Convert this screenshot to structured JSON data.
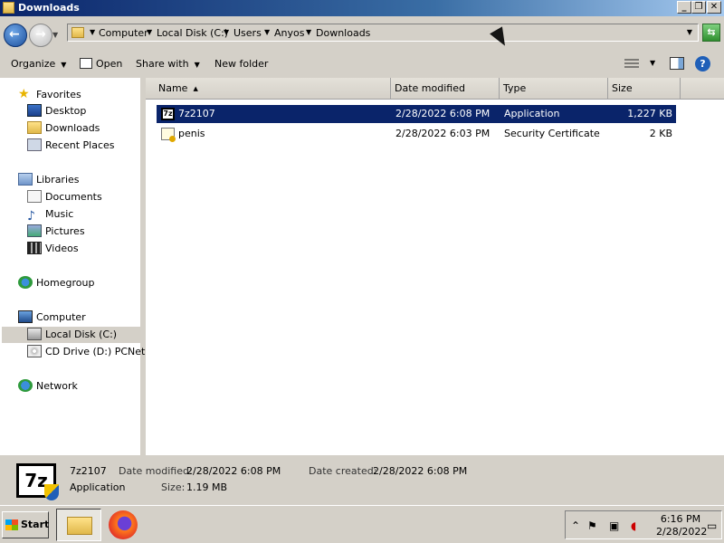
{
  "window": {
    "title": "Downloads",
    "controls": {
      "minimize": "_",
      "maximize": "❐",
      "close": "✕"
    }
  },
  "address": {
    "crumbs": [
      "Computer",
      "Local Disk (C:)",
      "Users",
      "Anyos",
      "Downloads"
    ]
  },
  "toolbar": {
    "organize": "Organize",
    "open": "Open",
    "share_with": "Share with",
    "new_folder": "New folder",
    "help": "?"
  },
  "nav": {
    "favorites": "Favorites",
    "desktop": "Desktop",
    "downloads": "Downloads",
    "recent_places": "Recent Places",
    "libraries": "Libraries",
    "documents": "Documents",
    "music": "Music",
    "pictures": "Pictures",
    "videos": "Videos",
    "homegroup": "Homegroup",
    "computer": "Computer",
    "local_disk": "Local Disk (C:)",
    "cd_drive": "CD Drive (D:) PCNet",
    "network": "Network"
  },
  "columns": {
    "name": "Name",
    "date_modified": "Date modified",
    "type": "Type",
    "size": "Size"
  },
  "files": [
    {
      "name": "7z2107",
      "date": "2/28/2022 6:08 PM",
      "type": "Application",
      "size": "1,227 KB",
      "selected": true
    },
    {
      "name": "penis",
      "date": "2/28/2022 6:03 PM",
      "type": "Security Certificate",
      "size": "2 KB",
      "selected": false
    }
  ],
  "details": {
    "icon_text": "7z",
    "name": "7z2107",
    "type": "Application",
    "date_modified_label": "Date modified:",
    "date_modified": "2/28/2022 6:08 PM",
    "date_created_label": "Date created:",
    "date_created": "2/28/2022 6:08 PM",
    "size_label": "Size:",
    "size": "1.19 MB"
  },
  "taskbar": {
    "start": "Start",
    "time": "6:16 PM",
    "date": "2/28/2022"
  }
}
